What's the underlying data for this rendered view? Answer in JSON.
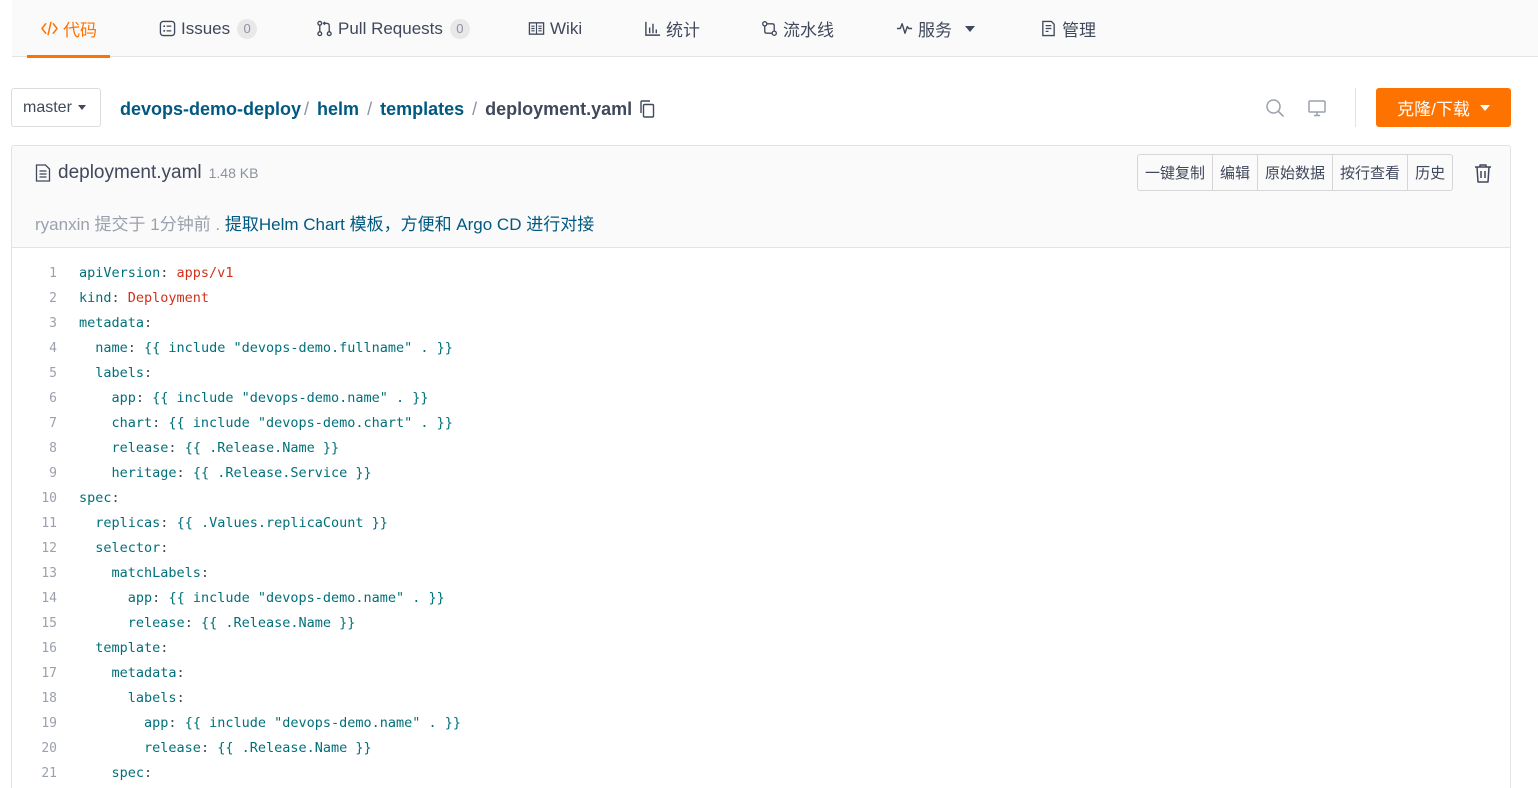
{
  "nav": {
    "tabs": [
      {
        "id": "code",
        "label": "代码",
        "icon": "code-icon",
        "active": true
      },
      {
        "id": "issues",
        "label": "Issues",
        "count": "0",
        "icon": "issues-icon"
      },
      {
        "id": "pulls",
        "label": "Pull Requests",
        "count": "0",
        "icon": "pull-request-icon"
      },
      {
        "id": "wiki",
        "label": "Wiki",
        "icon": "book-icon"
      },
      {
        "id": "stats",
        "label": "统计",
        "icon": "bar-chart-icon"
      },
      {
        "id": "pipeline",
        "label": "流水线",
        "icon": "pipeline-icon"
      },
      {
        "id": "services",
        "label": "服务",
        "icon": "pulse-icon",
        "dropdown": true
      },
      {
        "id": "manage",
        "label": "管理",
        "icon": "document-settings-icon"
      }
    ]
  },
  "repo": {
    "branch": "master",
    "breadcrumb": [
      "devops-demo-deploy",
      "helm",
      "templates"
    ],
    "separator": "/",
    "current_file": "deployment.yaml",
    "clone_label": "克隆/下载",
    "accent_color": "#fe7300"
  },
  "file": {
    "name": "deployment.yaml",
    "size": "1.48 KB",
    "actions": [
      "一键复制",
      "编辑",
      "原始数据",
      "按行查看",
      "历史"
    ],
    "commit_meta": "ryanxin 提交于 1分钟前 .",
    "commit_message": "提取Helm Chart 模板，方便和 Argo CD 进行对接"
  },
  "code": {
    "lines": [
      {
        "n": "1",
        "indent": "",
        "key": "apiVersion",
        "sep": ": ",
        "value": "apps/v1",
        "vtype": "v"
      },
      {
        "n": "2",
        "indent": "",
        "key": "kind",
        "sep": ": ",
        "value": "Deployment",
        "vtype": "v"
      },
      {
        "n": "3",
        "indent": "",
        "key": "metadata",
        "sep": ":",
        "value": "",
        "vtype": "k"
      },
      {
        "n": "4",
        "indent": "  ",
        "key": "name",
        "sep": ": ",
        "value": "{{ include \"devops-demo.fullname\" . }}",
        "vtype": "k"
      },
      {
        "n": "5",
        "indent": "  ",
        "key": "labels",
        "sep": ":",
        "value": "",
        "vtype": "k"
      },
      {
        "n": "6",
        "indent": "    ",
        "key": "app",
        "sep": ": ",
        "value": "{{ include \"devops-demo.name\" . }}",
        "vtype": "k"
      },
      {
        "n": "7",
        "indent": "    ",
        "key": "chart",
        "sep": ": ",
        "value": "{{ include \"devops-demo.chart\" . }}",
        "vtype": "k"
      },
      {
        "n": "8",
        "indent": "    ",
        "key": "release",
        "sep": ": ",
        "value": "{{ .Release.Name }}",
        "vtype": "k"
      },
      {
        "n": "9",
        "indent": "    ",
        "key": "heritage",
        "sep": ": ",
        "value": "{{ .Release.Service }}",
        "vtype": "k"
      },
      {
        "n": "10",
        "indent": "",
        "key": "spec",
        "sep": ":",
        "value": "",
        "vtype": "k"
      },
      {
        "n": "11",
        "indent": "  ",
        "key": "replicas",
        "sep": ": ",
        "value": "{{ .Values.replicaCount }}",
        "vtype": "k"
      },
      {
        "n": "12",
        "indent": "  ",
        "key": "selector",
        "sep": ":",
        "value": "",
        "vtype": "k"
      },
      {
        "n": "13",
        "indent": "    ",
        "key": "matchLabels",
        "sep": ":",
        "value": "",
        "vtype": "k"
      },
      {
        "n": "14",
        "indent": "      ",
        "key": "app",
        "sep": ": ",
        "value": "{{ include \"devops-demo.name\" . }}",
        "vtype": "k"
      },
      {
        "n": "15",
        "indent": "      ",
        "key": "release",
        "sep": ": ",
        "value": "{{ .Release.Name }}",
        "vtype": "k"
      },
      {
        "n": "16",
        "indent": "  ",
        "key": "template",
        "sep": ":",
        "value": "",
        "vtype": "k"
      },
      {
        "n": "17",
        "indent": "    ",
        "key": "metadata",
        "sep": ":",
        "value": "",
        "vtype": "k"
      },
      {
        "n": "18",
        "indent": "      ",
        "key": "labels",
        "sep": ":",
        "value": "",
        "vtype": "k"
      },
      {
        "n": "19",
        "indent": "        ",
        "key": "app",
        "sep": ": ",
        "value": "{{ include \"devops-demo.name\" . }}",
        "vtype": "k"
      },
      {
        "n": "20",
        "indent": "        ",
        "key": "release",
        "sep": ": ",
        "value": "{{ .Release.Name }}",
        "vtype": "k"
      },
      {
        "n": "21",
        "indent": "    ",
        "key": "spec",
        "sep": ":",
        "value": "",
        "vtype": "k"
      }
    ]
  }
}
